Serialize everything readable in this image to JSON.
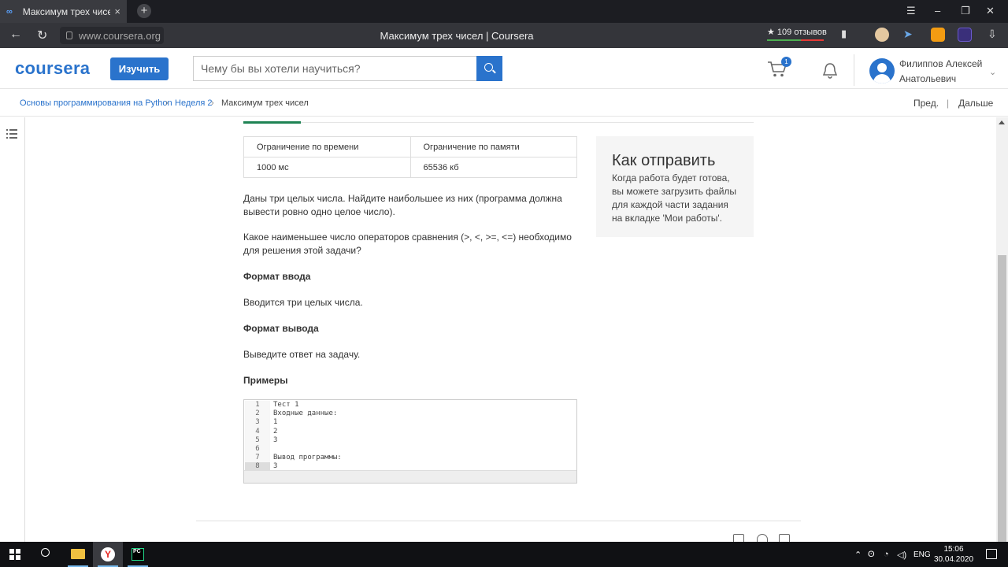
{
  "browser": {
    "tab_title": "Максимум трех чисел | C",
    "tab_close": "×",
    "new_tab": "+",
    "url": "www.coursera.org",
    "page_title": "Максимум трех чисел | Coursera",
    "reviews": "★ 109 отзывов",
    "window_controls": {
      "menu": "☰",
      "minimize": "–",
      "restore": "❐",
      "close": "✕"
    }
  },
  "header": {
    "logo": "coursera",
    "explore_label": "Изучить",
    "search_placeholder": "Чему бы вы хотели научиться?",
    "cart_count": "1",
    "user_name": "Филиппов Алексей Анатольевич"
  },
  "breadcrumb": {
    "items": [
      "Основы программирования на Python",
      "Неделя 2",
      "Максимум трех чисел"
    ],
    "prev": "Пред.",
    "divider": "|",
    "next": "Дальше"
  },
  "limits": {
    "headers": [
      "Ограничение по времени",
      "Ограничение по памяти"
    ],
    "values": [
      "1000 мс",
      "65536 кб"
    ]
  },
  "problem": {
    "statement": "Даны три целых числа. Найдите наибольшее из них (программа должна вывести ровно одно целое число).",
    "question": "Какое наименьшее число операторов сравнения (>, <, >=, <=) необходимо для решения этой задачи?",
    "input_heading": "Формат ввода",
    "input_text": "Вводится три целых числа.",
    "output_heading": "Формат вывода",
    "output_text": "Выведите ответ на задачу.",
    "examples_heading": "Примеры"
  },
  "code_lines": [
    {
      "num": "1",
      "text": "Тест 1"
    },
    {
      "num": "2",
      "text": "Входные данные:"
    },
    {
      "num": "3",
      "text": "1"
    },
    {
      "num": "4",
      "text": "2"
    },
    {
      "num": "5",
      "text": "3"
    },
    {
      "num": "6",
      "text": ""
    },
    {
      "num": "7",
      "text": "Вывод программы:"
    },
    {
      "num": "8",
      "text": "3"
    }
  ],
  "howto": {
    "heading": "Как отправить",
    "text": "Когда работа будет готова, вы можете загрузить файлы для каждой части задания на вкладке 'Мои работы'."
  },
  "taskbar": {
    "lang": "ENG",
    "time": "15:06",
    "date": "30.04.2020"
  },
  "colors": {
    "brand": "#2a73cc",
    "active_tab": "#1f8354"
  }
}
